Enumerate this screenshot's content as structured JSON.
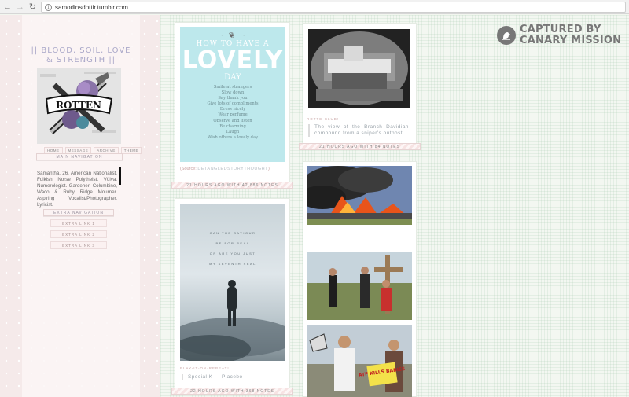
{
  "browser": {
    "back_icon": "←",
    "forward_icon": "→",
    "reload_icon": "↻",
    "info_icon": "i",
    "url": "samodinsdottir.tumblr.com"
  },
  "sidebar": {
    "blog_title": "|| BLOOD, SOIL, LOVE & STRENGTH ||",
    "avatar_banner": "ROTTEN",
    "nav": [
      "HOME",
      "MESSAGE",
      "ARCHIVE",
      "THEME"
    ],
    "main_nav_label": "MAIN NAVIGATION",
    "bio": "Samantha. 26. American Nationalist. Folkish Norse Polytheist. Völva. Numerologist. Gardener. Columbine, Waco & Ruby Ridge Mourner. Aspiring Vocalist/Photographer. Lyricist.",
    "extra_nav_label": "EXTRA NAVIGATION",
    "extra_links": [
      "EXTRA LINK 1",
      "EXTRA LINK 2",
      "EXTRA LINK 3"
    ]
  },
  "posts": {
    "quote": {
      "ornament": "~ ❦ ~",
      "heading_small": "HOW TO HAVE A",
      "heading_big": "LOVELY",
      "heading_day": "DAY",
      "lines": [
        "Smile at strangers",
        "Slow down",
        "Say thank you",
        "Give lots of compliments",
        "Dress nicely",
        "Wear perfume",
        "Observe and listen",
        "Be charming",
        "Laugh",
        "Wish others a lovely day"
      ],
      "source_prefix": "(Source:",
      "source_link": "DETANGLEDSTORYTHOUGHT",
      "source_suffix": ")",
      "notes": "21 HOURS AGO WITH 42,886 NOTES"
    },
    "branch": {
      "tag": "ROTTE-CLUB!",
      "caption": "The view of the Branch Davidian compound from a sniper's outpost.",
      "notes": "21 HOURS AGO WITH 84 NOTES"
    },
    "song": {
      "lyrics": [
        "CAN THE SAVIOUR",
        "BE FOR REAL",
        "OR ARE YOU JUST",
        "MY SEVENTH SEAL"
      ],
      "tag": "PLAY-IT-ON-REPEAT!",
      "caption": "Special K — Placebo",
      "notes": "22 HOURS AGO WITH 368 NOTES"
    },
    "photoset": {
      "sign_text": "ATF KILLS BABIES"
    }
  },
  "watermark": {
    "line1": "CAPTURED BY",
    "line2": "CANARY MISSION"
  }
}
